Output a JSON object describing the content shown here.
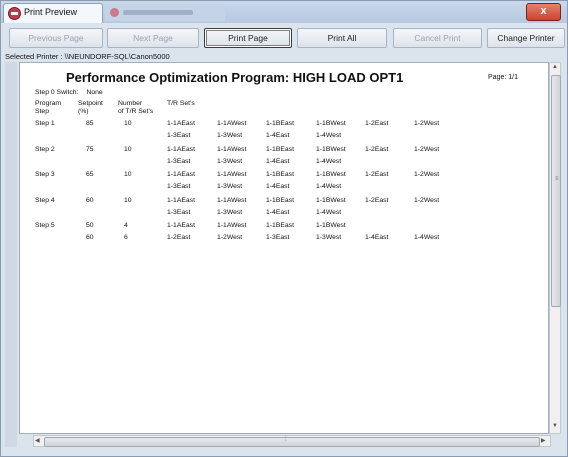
{
  "window": {
    "tab_title": "Print Preview",
    "close_label": "x"
  },
  "toolbar": {
    "previous_page": "Previous Page",
    "next_page": "Next Page",
    "print_page": "Print Page",
    "print_all": "Print All",
    "cancel_print": "Cancel Print",
    "change_printer": "Change Printer"
  },
  "printer": {
    "label": "Selected Printer :",
    "name": "\\\\NEUNDORF-SQL\\Canon5000"
  },
  "report": {
    "title": "Performance Optimization Program: HIGH LOAD OPT1",
    "page": "Page: 1/1",
    "step0_label": "Step 0 Switch:",
    "step0_value": "None",
    "headers": {
      "program_step": [
        "Program",
        "Step"
      ],
      "setpoint": [
        "Setpoint",
        "(%)"
      ],
      "number": [
        "Number",
        "of T/R Set's"
      ],
      "tr_sets": "T/R Set's"
    },
    "rows": [
      {
        "step": "Step 1",
        "setpoint": "85",
        "number": "10",
        "sets": [
          "1-1AEast",
          "1-1AWest",
          "1-1BEast",
          "1-1BWest",
          "1-2East",
          "1-2West",
          "1-3East",
          "1-3West",
          "1-4East",
          "1-4West"
        ]
      },
      {
        "step": "Step 2",
        "setpoint": "75",
        "number": "10",
        "sets": [
          "1-1AEast",
          "1-1AWest",
          "1-1BEast",
          "1-1BWest",
          "1-2East",
          "1-2West",
          "1-3East",
          "1-3West",
          "1-4East",
          "1-4West"
        ]
      },
      {
        "step": "Step 3",
        "setpoint": "65",
        "number": "10",
        "sets": [
          "1-1AEast",
          "1-1AWest",
          "1-1BEast",
          "1-1BWest",
          "1-2East",
          "1-2West",
          "1-3East",
          "1-3West",
          "1-4East",
          "1-4West"
        ]
      },
      {
        "step": "Step 4",
        "setpoint": "60",
        "number": "10",
        "sets": [
          "1-1AEast",
          "1-1AWest",
          "1-1BEast",
          "1-1BWest",
          "1-2East",
          "1-2West",
          "1-3East",
          "1-3West",
          "1-4East",
          "1-4West"
        ]
      },
      {
        "step": "Step 5",
        "setpoint": "50",
        "number": "4",
        "sets": [
          "1-1AEast",
          "1-1AWest",
          "1-1BEast",
          "1-1BWest"
        ]
      },
      {
        "step": "",
        "setpoint": "60",
        "number": "6",
        "sets": [
          "1-2East",
          "1-2West",
          "1-3East",
          "1-3West",
          "1-4East",
          "1-4West"
        ]
      }
    ]
  }
}
